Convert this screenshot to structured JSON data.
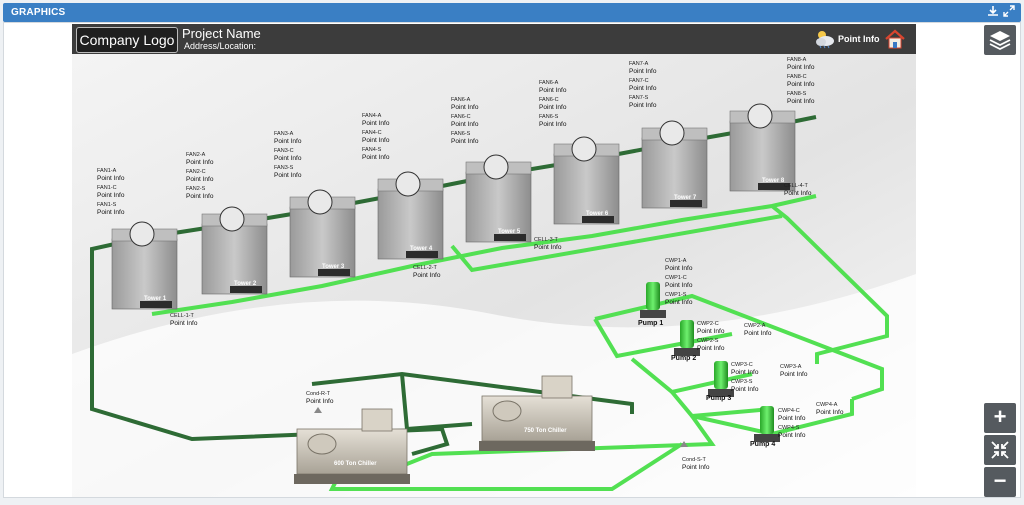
{
  "panel": {
    "title": "GRAPHICS"
  },
  "header": {
    "logo": "Company Logo",
    "project_name": "Project Name",
    "address": "Address/Location:",
    "point_info": "Point Info"
  },
  "towers": [
    {
      "name": "Tower 1",
      "fans": [
        "FAN1-A",
        "FAN1-C",
        "FAN1-S"
      ],
      "cell": "CELL-1-T"
    },
    {
      "name": "Tower 2",
      "fans": [
        "FAN2-A",
        "FAN2-C",
        "FAN2-S"
      ]
    },
    {
      "name": "Tower 3",
      "fans": [
        "FAN3-A",
        "FAN3-C",
        "FAN3-S"
      ]
    },
    {
      "name": "Tower 4",
      "fans": [
        "FAN4-A",
        "FAN4-C",
        "FAN4-S"
      ],
      "cell": "CELL-2-T"
    },
    {
      "name": "Tower 5",
      "fans": [
        "FAN6-A",
        "FAN6-C",
        "FAN6-S"
      ]
    },
    {
      "name": "Tower 6",
      "fans": [
        "FAN6-A",
        "FAN6-C",
        "FAN6-S"
      ],
      "cell": "CELL-3-T"
    },
    {
      "name": "Tower 7",
      "fans": [
        "FAN7-A",
        "FAN7-C",
        "FAN7-S"
      ]
    },
    {
      "name": "Tower 8",
      "fans": [
        "FAN8-A",
        "FAN8-C",
        "FAN8-S"
      ],
      "cell": "CELL-4-T"
    }
  ],
  "point_info_text": "Point Info",
  "pumps": [
    {
      "name": "Pump 1",
      "tags": [
        "CWP1-A",
        "CWP1-C",
        "CWP1-S"
      ]
    },
    {
      "name": "Pump 2",
      "tags": [
        "CWP2-C",
        "CWP2-S",
        "CWP2-A"
      ]
    },
    {
      "name": "Pump 3",
      "tags": [
        "CWP3-C",
        "CWP3-S",
        "CWP3-A"
      ]
    },
    {
      "name": "Pump 4",
      "tags": [
        "CWP4-C",
        "CWP4-S",
        "CWP4-A"
      ]
    }
  ],
  "chillers": [
    {
      "name": "600 Ton Chiller"
    },
    {
      "name": "750 Ton Chiller"
    }
  ],
  "cond_sensors": [
    "Cond-R-T",
    "Cond-S-T"
  ],
  "colors": {
    "header_blue": "#3a7fc4",
    "supply_green": "#52e052",
    "return_green": "#2e6b35",
    "rail_gray": "#555a5f"
  },
  "icons": {
    "download": "download-icon",
    "expand": "expand-icon",
    "layers": "layers-icon",
    "zoom_in": "zoom-in-icon",
    "fit": "fit-screen-icon",
    "zoom_out": "zoom-out-icon",
    "weather": "weather-icon",
    "home": "home-icon"
  }
}
